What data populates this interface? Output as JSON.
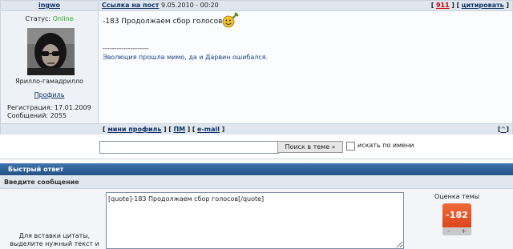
{
  "user": {
    "name": "ingwo",
    "status_label": "Статус:",
    "status_value": "Online",
    "title": "Ярилло-гамадрилло",
    "profile_link": "Профиль",
    "reg_label": "Регистрация:",
    "reg_date": "17.01.2009",
    "posts_label": "Сообщений:",
    "posts_count": "2055"
  },
  "post": {
    "link_label": "Ссылка на пост",
    "date": "9.05.2010 - 00:20",
    "post_number": "911",
    "quote_label": "цитировать",
    "text": "-183 Продолжаем сбор голосов",
    "sig_divider": "--------------------",
    "signature": "Эволюция прошла мимо, да и Дарвин ошибался."
  },
  "footer": {
    "mini_profile": "мини профиль",
    "pm": "ПМ",
    "email": "e-mail",
    "top": "^"
  },
  "search": {
    "input_value": "",
    "button_label": "Поиск в теме »",
    "checkbox_label": "искать по имени"
  },
  "quick_reply": {
    "title": "Быстрый ответ",
    "subtitle": "Введите сообщение",
    "textarea_value": "[quote]-183 Продолжаем сбор голосов[/quote]",
    "hint": "Для вставки цитаты, выделите нужный текст и",
    "rating_label": "Оценка темы",
    "rating_value": "-182",
    "minus": "–",
    "plus": "+"
  },
  "colors": {
    "online": "#22aa22",
    "signature": "#1d3f8a",
    "post_number": "#cc0000",
    "accent": "#2e5e99"
  }
}
